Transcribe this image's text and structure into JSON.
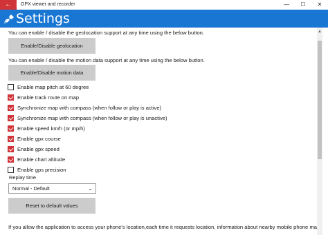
{
  "window": {
    "title": "GPX viewer and recorder",
    "back_glyph": "←",
    "minimize_glyph": "—",
    "maximize_glyph": "☐",
    "close_glyph": "✕"
  },
  "header": {
    "title": "Settings",
    "accent_color": "#1976d2"
  },
  "geolocation": {
    "info": "You can enable / disable the geolocation support at any time using the below button.",
    "button_label": "Enable/Disable geolocation"
  },
  "motion": {
    "info": "You can enable / disable the motion data support at any time using the below button.",
    "button_label": "Enable/Disable motion data"
  },
  "options": [
    {
      "label": "Enable map pitch at 60 degree",
      "checked": false
    },
    {
      "label": "Enable track route on map",
      "checked": true
    },
    {
      "label": "Synchronize map with compass (when follow or play is active)",
      "checked": true
    },
    {
      "label": "Synchronize map with compass (when follow or play is unactive)",
      "checked": true
    },
    {
      "label": "Enable speed km/h (or mp/h)",
      "checked": true
    },
    {
      "label": "Enable gpx course",
      "checked": true
    },
    {
      "label": "Enable gpx speed",
      "checked": true
    },
    {
      "label": "Enable chart altitude",
      "checked": true
    },
    {
      "label": "Enable gps precision",
      "checked": false
    }
  ],
  "replay": {
    "label": "Replay time",
    "selected": "Normal - Default"
  },
  "reset": {
    "button_label": "Reset to default values"
  },
  "privacy_text": "If you allow the application to access your phone's location,each time it requests location, information about nearby mobile phone masts, WiFi",
  "checked_color": "#d13438"
}
